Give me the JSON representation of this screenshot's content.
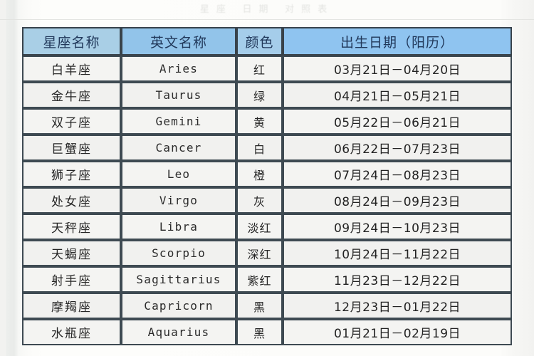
{
  "page": {
    "faint_heading": "星座 日期 对照表"
  },
  "table": {
    "name": "zodiac-date-table",
    "columns": [
      {
        "key": "cn_name",
        "label": "星座名称",
        "header_color": "#a9cfe6"
      },
      {
        "key": "en_name",
        "label": "英文名称",
        "header_color": "#92c4ea"
      },
      {
        "key": "color",
        "label": "颜色",
        "header_color": "#a5cdea"
      },
      {
        "key": "date",
        "label": "出生日期（阳历）",
        "header_color": "#8fc4f0"
      }
    ],
    "rows": [
      {
        "cn_name": "白羊座",
        "en_name": "Aries",
        "color": "红",
        "date": "03月21日－04月20日"
      },
      {
        "cn_name": "金牛座",
        "en_name": "Taurus",
        "color": "绿",
        "date": "04月21日－05月21日"
      },
      {
        "cn_name": "双子座",
        "en_name": "Gemini",
        "color": "黄",
        "date": "05月22日－06月21日"
      },
      {
        "cn_name": "巨蟹座",
        "en_name": "Cancer",
        "color": "白",
        "date": "06月22日－07月23日"
      },
      {
        "cn_name": "狮子座",
        "en_name": "Leo",
        "color": "橙",
        "date": "07月24日－08月23日"
      },
      {
        "cn_name": "处女座",
        "en_name": "Virgo",
        "color": "灰",
        "date": "08月24日－09月23日"
      },
      {
        "cn_name": "天秤座",
        "en_name": "Libra",
        "color": "淡红",
        "date": "09月24日－10月23日"
      },
      {
        "cn_name": "天蝎座",
        "en_name": "Scorpio",
        "color": "深红",
        "date": "10月24日－11月22日"
      },
      {
        "cn_name": "射手座",
        "en_name": "Sagittarius",
        "color": "紫红",
        "date": "11月23日－12月22日"
      },
      {
        "cn_name": "摩羯座",
        "en_name": "Capricorn",
        "color": "黑",
        "date": "12月23日－01月22日"
      },
      {
        "cn_name": "水瓶座",
        "en_name": "Aquarius",
        "color": "黑",
        "date": "01月21日－02月19日"
      }
    ]
  }
}
